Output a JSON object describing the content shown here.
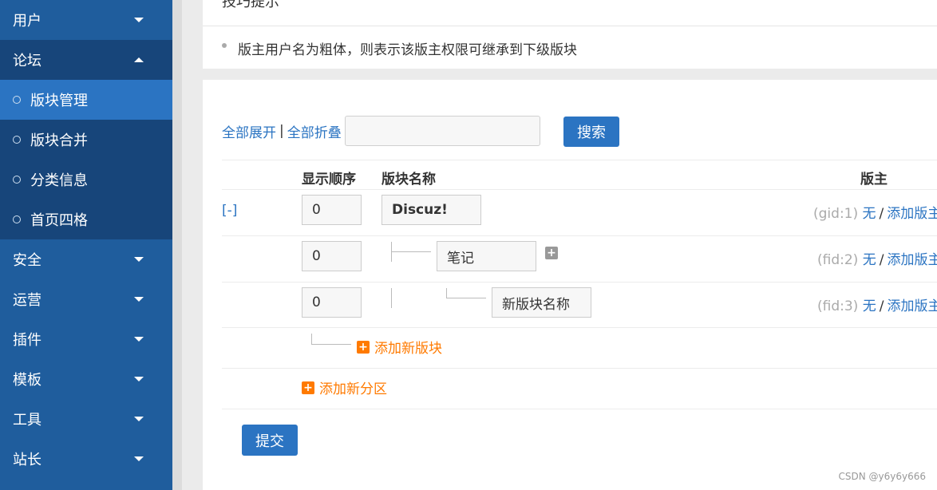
{
  "sidebar": {
    "items": [
      {
        "label": "用户",
        "expanded": false
      },
      {
        "label": "论坛",
        "expanded": true
      },
      {
        "label": "安全",
        "expanded": false
      },
      {
        "label": "运营",
        "expanded": false
      },
      {
        "label": "插件",
        "expanded": false
      },
      {
        "label": "模板",
        "expanded": false
      },
      {
        "label": "工具",
        "expanded": false
      },
      {
        "label": "站长",
        "expanded": false
      }
    ],
    "forum_sub": [
      {
        "label": "版块管理",
        "active": true
      },
      {
        "label": "版块合并",
        "active": false
      },
      {
        "label": "分类信息",
        "active": false
      },
      {
        "label": "首页四格",
        "active": false
      }
    ]
  },
  "tips": {
    "title": "技巧提示",
    "lines": [
      "版主用户名为粗体，则表示该版主权限可继承到下级版块"
    ]
  },
  "toolbar": {
    "expand_all": "全部展开",
    "separator": "|",
    "collapse_all": "全部折叠",
    "search_value": "",
    "search_button": "搜索"
  },
  "table": {
    "headers": {
      "order": "显示顺序",
      "name": "版块名称",
      "moderator": "版主"
    },
    "collapse_toggle": "[-]",
    "rows": [
      {
        "order": "0",
        "name": "Discuz!",
        "id_label": "(gid:1)",
        "mod": "无",
        "add_mod": "添加版主"
      },
      {
        "order": "0",
        "name": "笔记",
        "id_label": "(fid:2)",
        "mod": "无",
        "add_mod": "添加版主"
      },
      {
        "order": "0",
        "name": "新版块名称",
        "id_label": "(fid:3)",
        "mod": "无",
        "add_mod": "添加版主"
      }
    ],
    "add_forum": "添加新版块",
    "add_category": "添加新分区"
  },
  "submit": "提交",
  "watermark": "CSDN @y6y6y666",
  "colors": {
    "sidebar": "#1f5d9d",
    "sidebar_active": "#2b74c2",
    "link": "#2b74c2",
    "add": "#ff7a00"
  }
}
